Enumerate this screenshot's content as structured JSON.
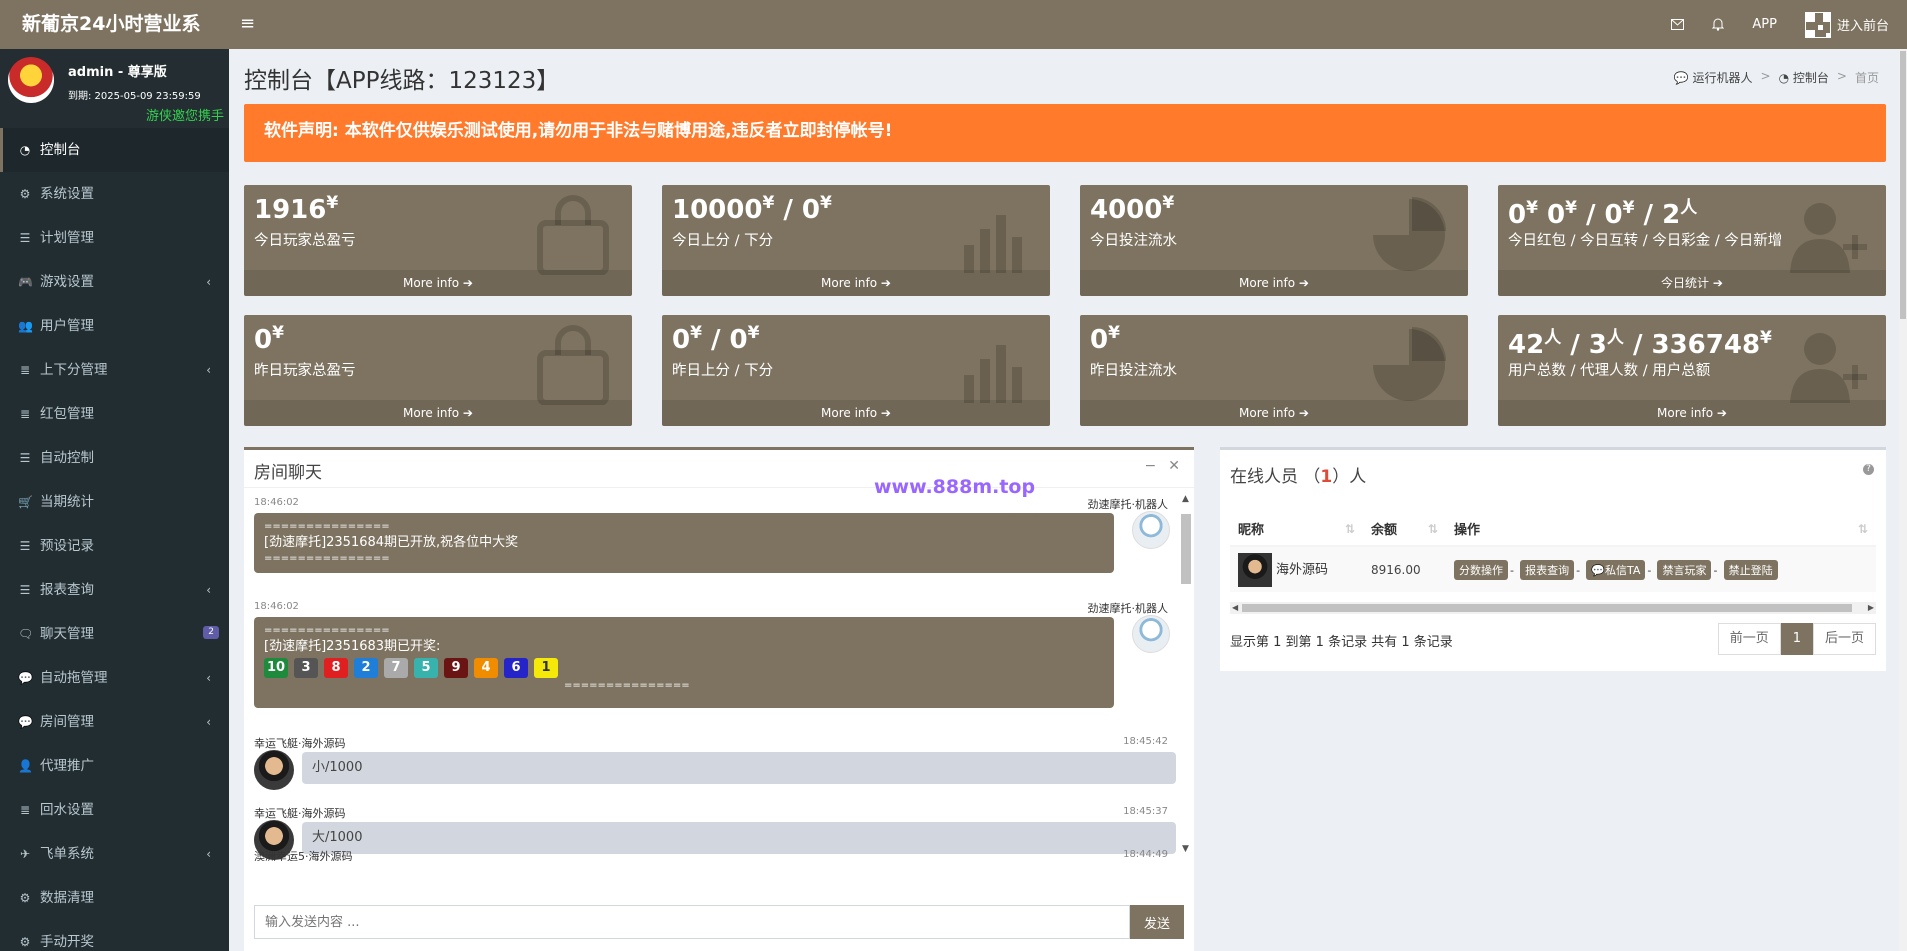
{
  "header": {
    "brand": "新葡京24小时营业系",
    "menu_toggle": "≡",
    "app_label": "APP",
    "enter_front": "进入前台"
  },
  "user": {
    "name": "admin - 尊享版",
    "expire": "到期: 2025-05-09 23:59:59",
    "marquee": "游侠邀您携手"
  },
  "sidebar": {
    "items": [
      {
        "label": "控制台",
        "icon": "dashboard-icon"
      },
      {
        "label": "系统设置",
        "icon": "cogs-icon"
      },
      {
        "label": "计划管理",
        "icon": "list-icon"
      },
      {
        "label": "游戏设置",
        "icon": "gamepad-icon"
      },
      {
        "label": "用户管理",
        "icon": "users-icon"
      },
      {
        "label": "上下分管理",
        "icon": "database-icon"
      },
      {
        "label": "红包管理",
        "icon": "database-icon"
      },
      {
        "label": "自动控制",
        "icon": "list-icon"
      },
      {
        "label": "当期统计",
        "icon": "cart-icon"
      },
      {
        "label": "预设记录",
        "icon": "list-icon"
      },
      {
        "label": "报表查询",
        "icon": "list-icon"
      },
      {
        "label": "聊天管理",
        "icon": "comments-icon",
        "badge": "2"
      },
      {
        "label": "自动拖管理",
        "icon": "comment-icon"
      },
      {
        "label": "房间管理",
        "icon": "comment-icon"
      },
      {
        "label": "代理推广",
        "icon": "user-plus-icon"
      },
      {
        "label": "回水设置",
        "icon": "database-icon"
      },
      {
        "label": "飞单系统",
        "icon": "paper-plane-icon"
      },
      {
        "label": "数据清理",
        "icon": "gear-icon"
      },
      {
        "label": "手动开奖",
        "icon": "gear-icon"
      }
    ]
  },
  "page": {
    "title": "控制台【APP线路：123123】",
    "breadcrumb": [
      "运行机器人",
      "控制台",
      "首页"
    ],
    "alert": "软件声明: 本软件仅供娱乐测试使用,请勿用于非法与赌博用途,违反者立即封停帐号!"
  },
  "stats": [
    {
      "value_html": "1916",
      "unit": "¥",
      "label": "今日玩家总盈亏",
      "more": "More info"
    },
    {
      "value_html": "10000",
      "unit": "¥",
      "value2": "0",
      "unit2": "¥",
      "label": "今日上分 / 下分",
      "more": "More info"
    },
    {
      "value_html": "4000",
      "unit": "¥",
      "label": "今日投注流水",
      "more": "More info"
    },
    {
      "value_html": "0",
      "unit": "¥",
      "label": "今日红包 / 今日互转 / 今日彩金 / 今日新增",
      "more": "今日统计"
    },
    {
      "value_html": "0",
      "unit": "¥",
      "label": "昨日玩家总盈亏",
      "more": "More info"
    },
    {
      "value_html": "0",
      "unit": "¥",
      "value2": "0",
      "unit2": "¥",
      "label": "昨日上分 / 下分",
      "more": "More info"
    },
    {
      "value_html": "0",
      "unit": "¥",
      "label": "昨日投注流水",
      "more": "More info"
    },
    {
      "value_html": "42",
      "unit": "人",
      "label": "用户总数 / 代理人数 / 用户总额",
      "more": "More info"
    }
  ],
  "stat_row_extra": {
    "s4": [
      "0",
      "¥",
      "0",
      "¥",
      "0",
      "¥",
      "2",
      "人"
    ],
    "s8": [
      "42",
      "人",
      "3",
      "人",
      "336748",
      "¥"
    ]
  },
  "chat": {
    "title": "房间聊天",
    "messages": [
      {
        "time": "18:46:02",
        "sender": "劲速摩托·机器人",
        "line1": "===============",
        "line2": "[劲速摩托]2351684期已开放,祝各位中大奖",
        "line3": "==============="
      },
      {
        "time": "18:46:02",
        "sender": "劲速摩托·机器人",
        "line1": "===============",
        "line2": "[劲速摩托]2351683期已开奖:",
        "balls": [
          "10",
          "3",
          "8",
          "2",
          "7",
          "5",
          "9",
          "4",
          "6",
          "1"
        ],
        "line3": "==============="
      },
      {
        "sender": "幸运飞艇·海外源码",
        "time": "18:45:42",
        "text": "小/1000"
      },
      {
        "sender": "幸运飞艇·海外源码",
        "time": "18:45:37",
        "text": "大/1000"
      },
      {
        "sender": "澳洲幸运5·海外源码",
        "time": "18:44:49"
      }
    ],
    "input_placeholder": "输入发送内容 ...",
    "send_label": "发送",
    "watermark": "www.888m.top"
  },
  "online": {
    "title_prefix": "在线人员 （",
    "count": "1",
    "title_suffix": "）人",
    "columns": [
      "昵称",
      "余额",
      "操作"
    ],
    "rows": [
      {
        "nickname": "海外源码",
        "balance": "8916.00",
        "actions": [
          "分数操作",
          "报表查询",
          "私信TA",
          "禁言玩家",
          "禁止登陆"
        ]
      }
    ],
    "info": "显示第 1 到第 1 条记录 共有 1 条记录",
    "prev": "前一页",
    "page": "1",
    "next": "后一页"
  },
  "colors": {
    "brand": "#7e7360",
    "alert": "#ff7a2b",
    "sidebar": "#222d32",
    "ball_colors": [
      "#1e8a3c",
      "#555555",
      "#e02020",
      "#1e7ed8",
      "#aaaaaa",
      "#38b2ac",
      "#6b1414",
      "#f08c00",
      "#2424c8",
      "#f5e90a"
    ]
  }
}
